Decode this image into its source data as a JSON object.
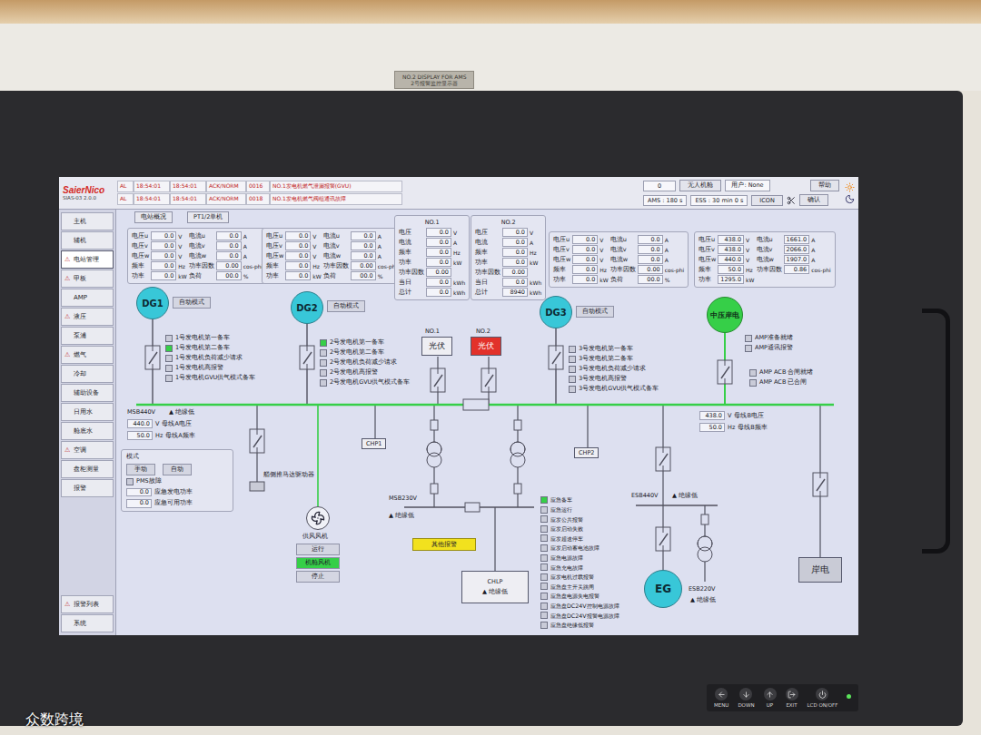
{
  "device": {
    "plate": "NO.2 DISPLAY FOR AMS",
    "plate_sub": "2号报警监控显示器",
    "watermark": "众数跨境",
    "controls": [
      {
        "label": "MENU"
      },
      {
        "label": "DOWN"
      },
      {
        "label": "UP"
      },
      {
        "label": "EXIT"
      },
      {
        "label": "LCD ON/OFF"
      }
    ],
    "led_on": true
  },
  "header": {
    "logo": "SaierNico",
    "version": "SIAS-03 2.0.0",
    "alarms": [
      {
        "cells": [
          "AL",
          "18:54:01",
          "18:54:01",
          "ACK/NORM",
          "0016",
          "NO.1发电机燃气泄漏报警(GVU)"
        ]
      },
      {
        "cells": [
          "AL",
          "18:54:01",
          "18:54:01",
          "ACK/NORM",
          "0018",
          "NO.1发电机燃气阀组通讯故障"
        ]
      }
    ],
    "count": "0",
    "mode": "无人机舱",
    "user": "用户: None",
    "ams": "AMS : 180 s",
    "ess": "ESS : 30 min 0 s",
    "icon_button": "ICON",
    "help": "帮助",
    "ack": "确认"
  },
  "sidebar": {
    "alarm_glyph": "⚠",
    "items": [
      {
        "label": "主机",
        "alarm": false,
        "selected": false
      },
      {
        "label": "辅机",
        "alarm": false,
        "selected": false
      },
      {
        "label": "电站管理",
        "alarm": true,
        "selected": true
      },
      {
        "label": "甲板",
        "alarm": true,
        "selected": false
      },
      {
        "label": "AMP",
        "alarm": false,
        "selected": false
      },
      {
        "label": "液压",
        "alarm": true,
        "selected": false
      },
      {
        "label": "泵浦",
        "alarm": false,
        "selected": false
      },
      {
        "label": "燃气",
        "alarm": true,
        "selected": false
      },
      {
        "label": "冷却",
        "alarm": false,
        "selected": false
      },
      {
        "label": "辅助设备",
        "alarm": false,
        "selected": false
      },
      {
        "label": "日用水",
        "alarm": false,
        "selected": false
      },
      {
        "label": "舱底水",
        "alarm": false,
        "selected": false
      },
      {
        "label": "空调",
        "alarm": true,
        "selected": false
      },
      {
        "label": "盘柜测量",
        "alarm": false,
        "selected": false
      },
      {
        "label": "报警",
        "alarm": false,
        "selected": false
      }
    ],
    "footer": [
      {
        "label": "报警列表",
        "alarm": true
      },
      {
        "label": "系统",
        "alarm": false
      }
    ]
  },
  "diagram": {
    "top_buttons": [
      "电站概况",
      "PT1/2单机"
    ],
    "generators": [
      {
        "label": "DG1",
        "mode": "自动模式",
        "energized": false,
        "rows": [
          [
            "电压u",
            "0.0",
            "V",
            "电流u",
            "0.0",
            "A"
          ],
          [
            "电压v",
            "0.0",
            "V",
            "电流v",
            "0.0",
            "A"
          ],
          [
            "电压w",
            "0.0",
            "V",
            "电流w",
            "0.0",
            "A"
          ],
          [
            "频率",
            "0.0",
            "Hz",
            "功率因数",
            "0.00",
            "cos-phi"
          ],
          [
            "功率",
            "0.0",
            "kW",
            "负荷",
            "00.0",
            "%"
          ]
        ],
        "status": [
          {
            "label": "1号发电机第一备车",
            "checked": false
          },
          {
            "label": "1号发电机第二备车",
            "checked": true
          },
          {
            "label": "1号发电机负荷减少请求",
            "checked": false
          },
          {
            "label": "1号发电机高报警",
            "checked": false
          },
          {
            "label": "1号发电机GVU供气模式备车",
            "checked": false
          }
        ]
      },
      {
        "label": "DG2",
        "mode": "自动模式",
        "energized": false,
        "rows": [
          [
            "电压u",
            "0.0",
            "V",
            "电流u",
            "0.0",
            "A"
          ],
          [
            "电压v",
            "0.0",
            "V",
            "电流v",
            "0.0",
            "A"
          ],
          [
            "电压w",
            "0.0",
            "V",
            "电流w",
            "0.0",
            "A"
          ],
          [
            "频率",
            "0.0",
            "Hz",
            "功率因数",
            "0.00",
            "cos-phi"
          ],
          [
            "功率",
            "0.0",
            "kW",
            "负荷",
            "00.0",
            "%"
          ]
        ],
        "status": [
          {
            "label": "2号发电机第一备车",
            "checked": true
          },
          {
            "label": "2号发电机第二备车",
            "checked": false
          },
          {
            "label": "2号发电机负荷减少请求",
            "checked": false
          },
          {
            "label": "2号发电机高报警",
            "checked": false
          },
          {
            "label": "2号发电机GVU供气模式备车",
            "checked": false
          }
        ]
      },
      {
        "label": "DG3",
        "mode": "自动模式",
        "energized": false,
        "rows": [
          [
            "电压u",
            "0.0",
            "V",
            "电流u",
            "0.0",
            "A"
          ],
          [
            "电压v",
            "0.0",
            "V",
            "电流v",
            "0.0",
            "A"
          ],
          [
            "电压w",
            "0.0",
            "V",
            "电流w",
            "0.0",
            "A"
          ],
          [
            "频率",
            "0.0",
            "Hz",
            "功率因数",
            "0.00",
            "cos-phi"
          ],
          [
            "功率",
            "0.0",
            "kW",
            "负荷",
            "00.0",
            "%"
          ]
        ],
        "status": [
          {
            "label": "3号发电机第一备车",
            "checked": false
          },
          {
            "label": "3号发电机第二备车",
            "checked": false
          },
          {
            "label": "3号发电机负荷减少请求",
            "checked": false
          },
          {
            "label": "3号发电机高报警",
            "checked": false
          },
          {
            "label": "3号发电机GVU供气模式备车",
            "checked": false
          }
        ]
      }
    ],
    "shore_mv": {
      "label": "中压岸电",
      "energized": true,
      "rows": [
        [
          "电压u",
          "438.0",
          "V",
          "电流u",
          "1661.0",
          "A"
        ],
        [
          "电压v",
          "438.0",
          "V",
          "电流v",
          "2066.0",
          "A"
        ],
        [
          "电压w",
          "440.0",
          "V",
          "电流w",
          "1907.0",
          "A"
        ],
        [
          "频率",
          "50.0",
          "Hz",
          "功率因数",
          "0.86",
          "cos-phi"
        ],
        [
          "功率",
          "1295.0",
          "kW",
          "",
          "",
          ""
        ]
      ],
      "status": [
        {
          "label": "AMP准备就绪",
          "checked": false
        },
        {
          "label": "AMP通讯报警",
          "checked": false
        }
      ],
      "acb": [
        {
          "label": "AMP ACB 合闸就绪",
          "checked": false
        },
        {
          "label": "AMP ACB 已合闸",
          "checked": false
        }
      ]
    },
    "pv": [
      {
        "tag": "NO.1",
        "label": "光伏",
        "alarm": false,
        "rows": [
          [
            "电压",
            "0.0",
            "V"
          ],
          [
            "电流",
            "0.0",
            "A"
          ],
          [
            "频率",
            "0.0",
            "Hz"
          ],
          [
            "功率",
            "0.0",
            "kW"
          ],
          [
            "功率因数",
            "0.00",
            ""
          ],
          [
            "当日",
            "0.0",
            "kWh"
          ],
          [
            "总计",
            "0.0",
            "kWh"
          ]
        ]
      },
      {
        "tag": "NO.2",
        "label": "光伏",
        "alarm": true,
        "rows": [
          [
            "电压",
            "0.0",
            "V"
          ],
          [
            "电流",
            "0.0",
            "A"
          ],
          [
            "频率",
            "0.0",
            "Hz"
          ],
          [
            "功率",
            "0.0",
            "kW"
          ],
          [
            "功率因数",
            "0.00",
            ""
          ],
          [
            "当日",
            "0.0",
            "kWh"
          ],
          [
            "总计",
            "8940",
            "kWh"
          ]
        ]
      }
    ],
    "bus": {
      "energized": true,
      "a": {
        "name": "MSB440V",
        "insulation": "▲ 绝缘低",
        "readings": [
          {
            "value": "440.0",
            "unit": "V",
            "label": "母线A电压"
          },
          {
            "value": "50.0",
            "unit": "Hz",
            "label": "母线A频率"
          }
        ]
      },
      "b": {
        "readings": [
          {
            "value": "438.0",
            "unit": "V",
            "label": "母线B电压"
          },
          {
            "value": "50.0",
            "unit": "Hz",
            "label": "母线B频率"
          }
        ]
      }
    },
    "thruster": "艏侧推马达驱动器",
    "fan": {
      "label": "供风风机",
      "energized": true,
      "buttons": [
        {
          "label": "运行",
          "active": false
        },
        {
          "label": "机舱风机",
          "active": true
        },
        {
          "label": "停止",
          "active": false
        }
      ]
    },
    "chp": [
      "CHP1",
      "CHP2"
    ],
    "msb230": {
      "name": "MSB230V",
      "insulation": "▲ 绝缘低"
    },
    "chlp": {
      "name": "CHLP",
      "insulation": "▲ 绝缘低"
    },
    "other_alarm": "其他报警",
    "esb440": {
      "name": "ESB440V",
      "insulation": "▲ 绝缘低"
    },
    "esb220": {
      "name": "ESB220V",
      "insulation": "▲ 绝缘低"
    },
    "eg": "EG",
    "shore": "岸电",
    "mode_box": {
      "title": "模式",
      "buttons": [
        {
          "label": "手动",
          "selected": false
        },
        {
          "label": "自动",
          "selected": false
        }
      ],
      "pms": {
        "label": "PMS故障",
        "checked": false
      },
      "values": [
        {
          "label": "应急发电功率",
          "value": "0.0"
        },
        {
          "label": "应急可用功率",
          "value": "0.0"
        }
      ]
    },
    "emergency": [
      {
        "label": "应急备车",
        "checked": true
      },
      {
        "label": "应急运行",
        "checked": false
      },
      {
        "label": "应发公共报警",
        "checked": false
      },
      {
        "label": "应发启动失败",
        "checked": false
      },
      {
        "label": "应发超速停车",
        "checked": false
      },
      {
        "label": "应发启动蓄电池故障",
        "checked": false
      },
      {
        "label": "应急电源故障",
        "checked": false
      },
      {
        "label": "应急充电故障",
        "checked": false
      },
      {
        "label": "应发电机过载报警",
        "checked": false
      },
      {
        "label": "应急盘主开关跳闸",
        "checked": false
      },
      {
        "label": "应急盘电源失电报警",
        "checked": false
      },
      {
        "label": "应急盘DC24V控制电源故障",
        "checked": false
      },
      {
        "label": "应急盘DC24V报警电源故障",
        "checked": false
      },
      {
        "label": "应急盘绝缘低报警",
        "checked": false
      }
    ]
  }
}
